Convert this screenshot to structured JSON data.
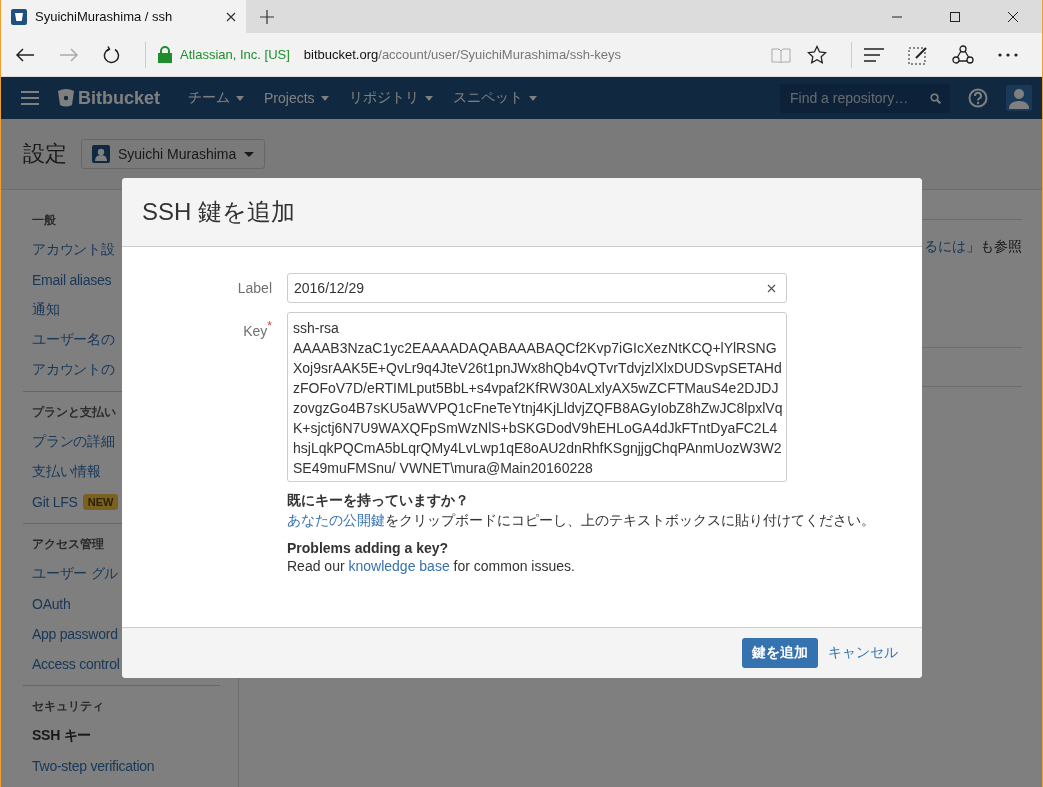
{
  "browser": {
    "tab_title": "SyuichiMurashima / ssh",
    "site_identity": "Atlassian, Inc. [US]",
    "url_host": "bitbucket.org",
    "url_path": "/account/user/SyuichiMurashima/ssh-keys"
  },
  "nav": {
    "brand": "Bitbucket",
    "menus": [
      {
        "label": "チーム"
      },
      {
        "label": "Projects"
      },
      {
        "label": "リポジトリ"
      },
      {
        "label": "スニペット"
      }
    ],
    "search": {
      "placeholder": "Find a repository…"
    }
  },
  "page": {
    "title": "設定",
    "account": "Syuichi Murashima"
  },
  "sidebar": [
    {
      "heading": "一般",
      "items": [
        {
          "label": "アカウント設",
          "selected": false
        },
        {
          "label": "Email aliases",
          "selected": false
        },
        {
          "label": "通知",
          "selected": false
        },
        {
          "label": "ユーザー名の",
          "selected": false
        },
        {
          "label": "アカウントの",
          "selected": false
        }
      ]
    },
    {
      "heading": "プランと支払い",
      "items": [
        {
          "label": "プランの詳細",
          "selected": false
        },
        {
          "label": "支払い情報",
          "selected": false
        },
        {
          "label": "Git LFS",
          "badge": "NEW",
          "selected": false
        }
      ]
    },
    {
      "heading": "アクセス管理",
      "items": [
        {
          "label": "ユーザー グル",
          "selected": false
        },
        {
          "label": "OAuth",
          "selected": false
        },
        {
          "label": "App password",
          "selected": false
        },
        {
          "label": "Access control",
          "selected": false
        }
      ]
    },
    {
      "heading": "セキュリティ",
      "items": [
        {
          "label": "SSH キー",
          "selected": true
        },
        {
          "label": "Two-step verification",
          "selected": false
        }
      ]
    }
  ],
  "background_text": {
    "link": "るには",
    "rest": "」も参照"
  },
  "modal": {
    "title": "SSH 鍵を追加",
    "label_field": {
      "label": "Label",
      "value": "2016/12/29"
    },
    "key_field": {
      "label": "Key",
      "required_mark": "*",
      "value": "ssh-rsa AAAAB3NzaC1yc2EAAAADAQABAAABAQCf2Kvp7iGIcXezNtKCQ+lYlRSNGXoj9srAAK5E+QvLr9q4JteV26t1pnJWx8hQb4vQTvrTdvjzlXlxDUDSvpSETAHdzFOFoV7D/eRTIMLput5BbL+s4vpaf2KfRW30ALxlyAX5wZCFTMauS4e2DJDJzovgzGo4B7sKU5aWVPQ1cFneTeYtnj4KjLldvjZQFB8AGyIobZ8hZwJC8lpxlVqK+sjctj6N7U9WAXQFpSmWzNlS+bSKGDodV9hEHLoGA4dJkFTntDyaFC2L4hsjLqkPQCmA5bLqrQMy4LvLwp1qE8oAU2dnRhfKSgnjjgChqPAnmUozW3W2SE49muFMSnu/ VWNET\\mura@Main20160228"
    },
    "help": [
      {
        "heading": "既にキーを持っていますか？",
        "parts": [
          {
            "text": "あなたの公開鍵",
            "link": true
          },
          {
            "text": "をクリップボードにコピーし、上のテキストボックスに貼り付けてください。",
            "link": false
          }
        ]
      },
      {
        "heading": "Problems adding a key?",
        "parts": [
          {
            "text": "Read our ",
            "link": false
          },
          {
            "text": "knowledge base",
            "link": true
          },
          {
            "text": " for common issues.",
            "link": false
          }
        ]
      }
    ],
    "buttons": [
      {
        "label": "鍵を追加",
        "kind": "primary"
      },
      {
        "label": "キャンセル",
        "kind": "link"
      }
    ]
  }
}
